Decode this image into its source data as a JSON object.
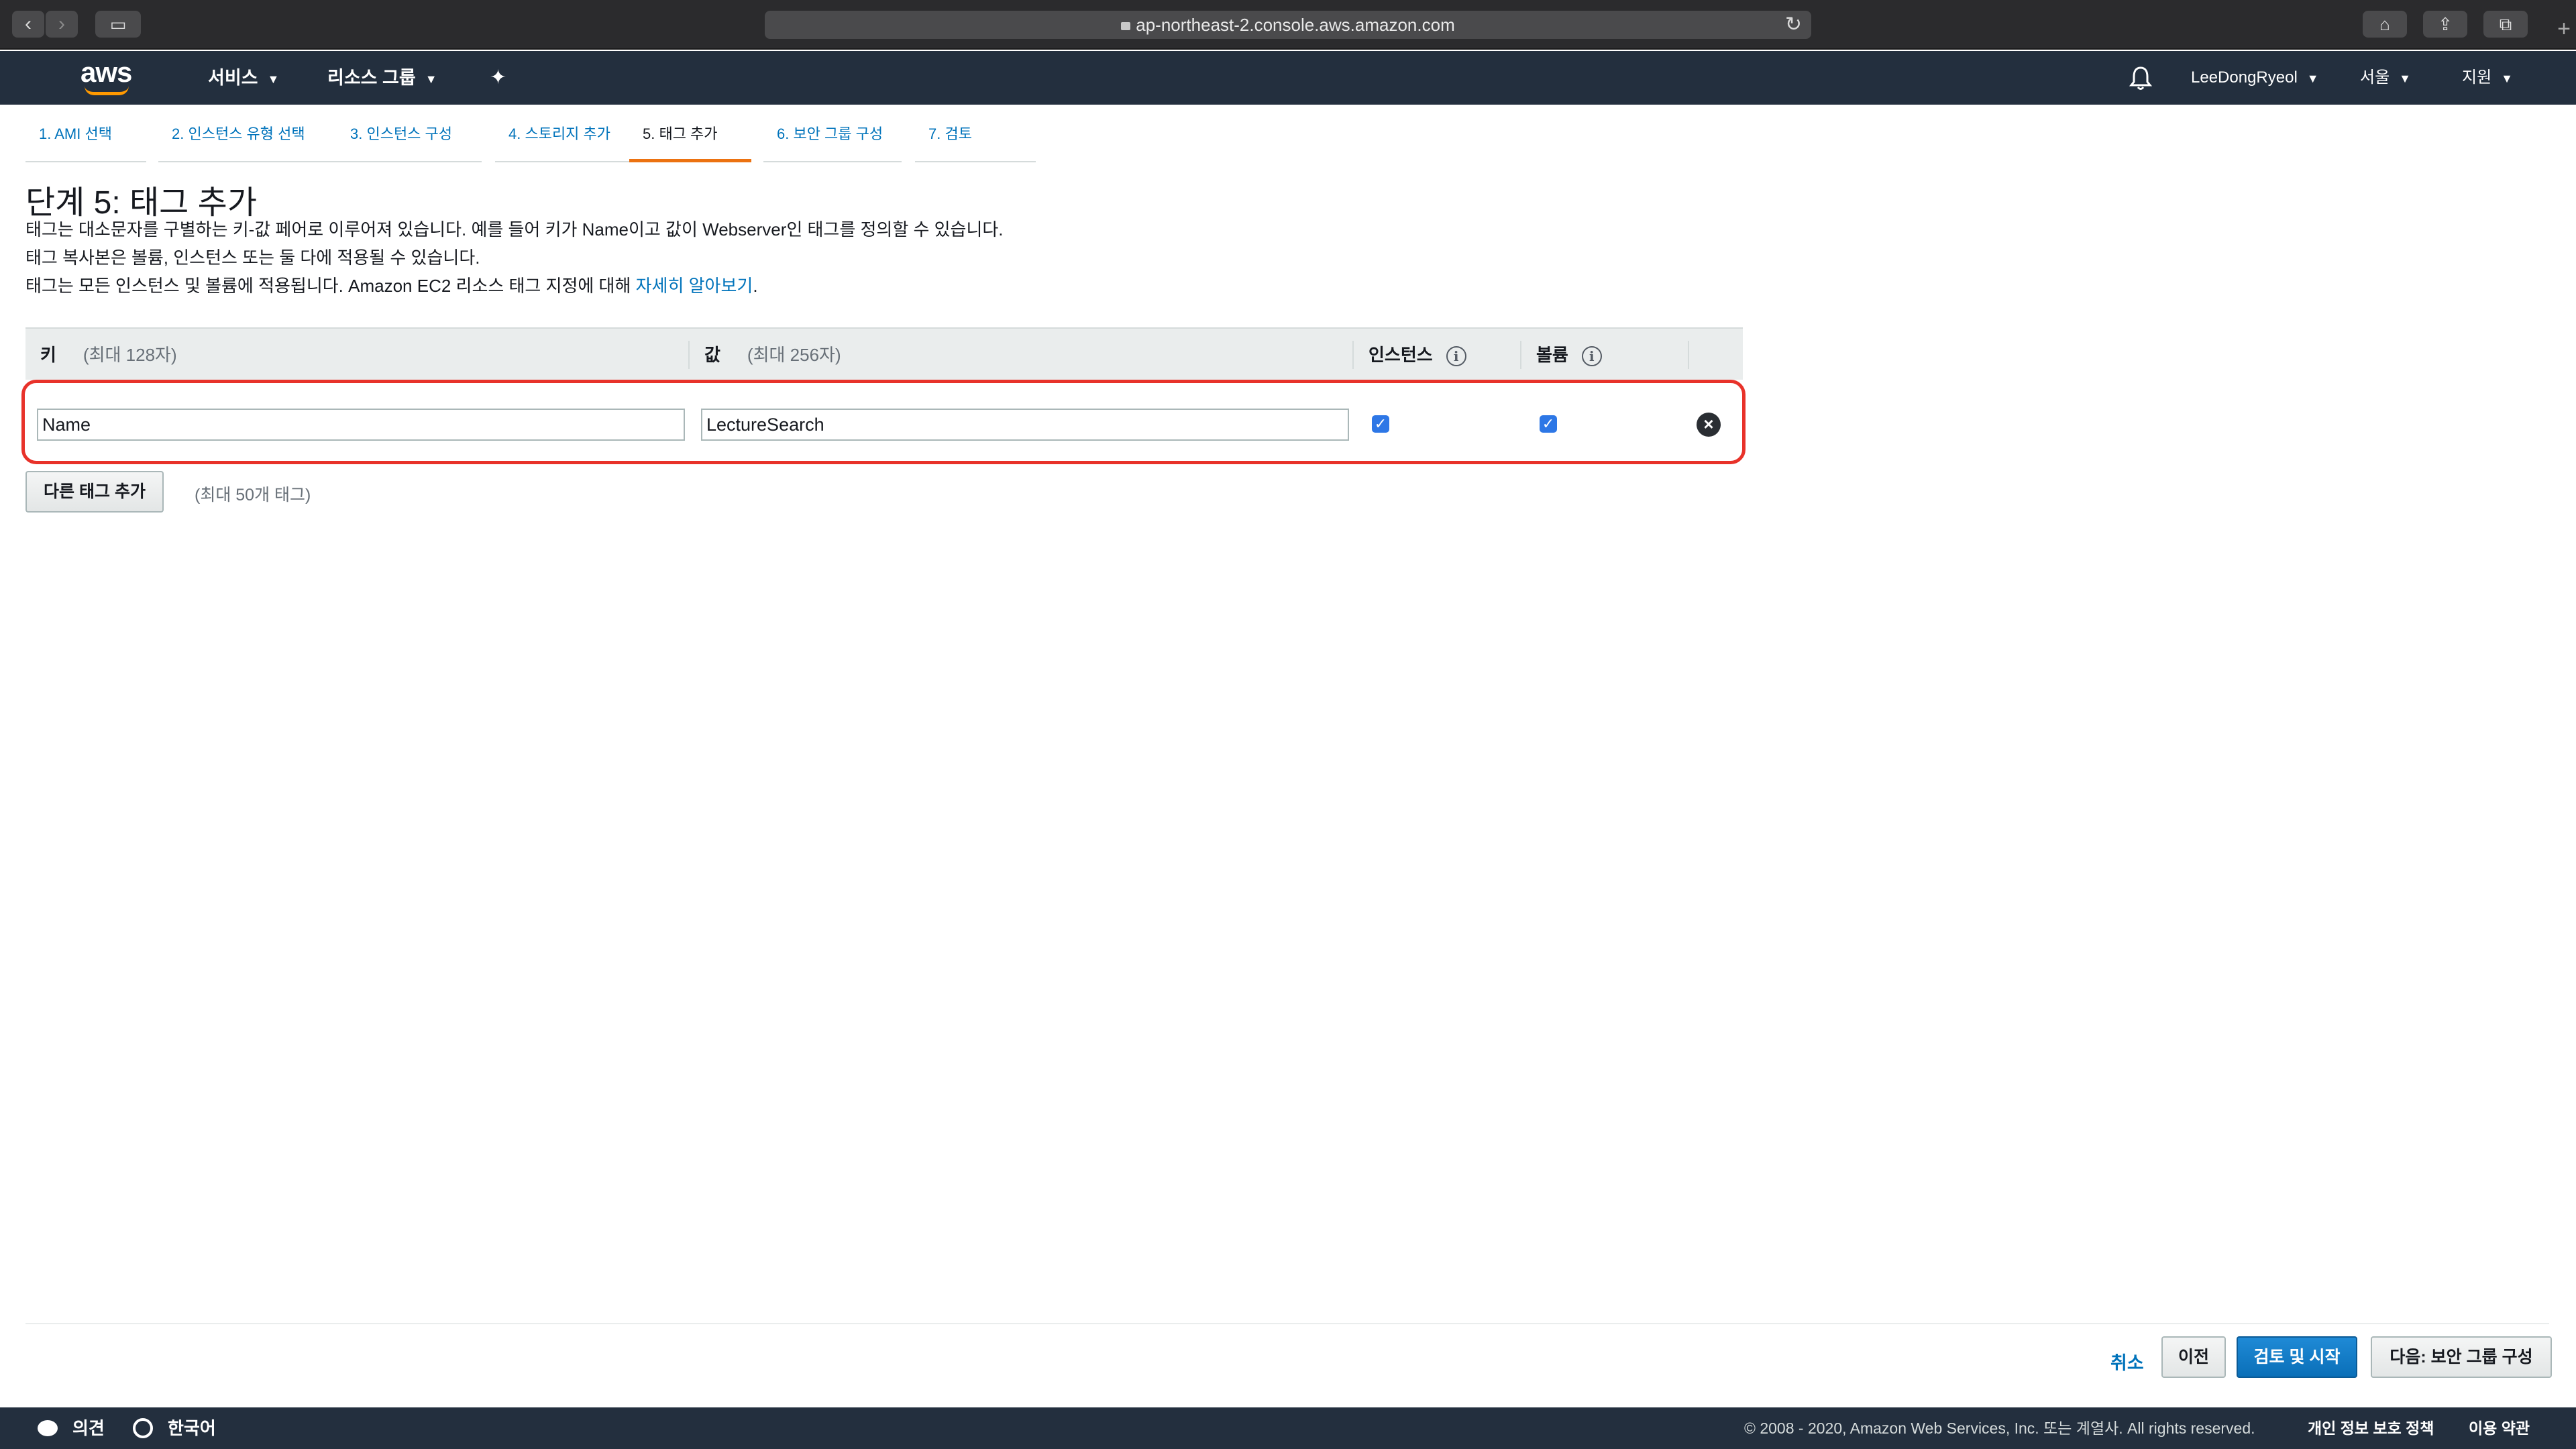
{
  "browser": {
    "url": "ap-northeast-2.console.aws.amazon.com",
    "back_icon": "‹",
    "forward_icon": "›",
    "sidebar_icon": "▭",
    "reload_icon": "↻",
    "home_icon": "⌂",
    "share_icon": "⇪",
    "tabs_icon": "⧉",
    "new_tab_icon": "+"
  },
  "header": {
    "logo": "aws",
    "services": "서비스",
    "resource_groups": "리소스 그룹",
    "pin_icon": "✦",
    "bell_icon": "🔔",
    "user": "LeeDongRyeol",
    "region": "서울",
    "support": "지원"
  },
  "steps": [
    {
      "label": "1. AMI 선택"
    },
    {
      "label": "2. 인스턴스 유형 선택"
    },
    {
      "label": "3. 인스턴스 구성"
    },
    {
      "label": "4. 스토리지 추가"
    },
    {
      "label": "5. 태그 추가"
    },
    {
      "label": "6. 보안 그룹 구성"
    },
    {
      "label": "7. 검토"
    }
  ],
  "page": {
    "title": "단계 5: 태그 추가",
    "desc1": "태그는 대소문자를 구별하는 키-값 페어로 이루어져 있습니다. 예를 들어 키가 Name이고 값이 Webserver인 태그를 정의할 수 있습니다.",
    "desc2": "태그 복사본은 볼륨, 인스턴스 또는 둘 다에 적용될 수 있습니다.",
    "desc3": "태그는 모든 인스턴스 및 볼륨에 적용됩니다. Amazon EC2 리소스 태그 지정에 대해",
    "learn_more": "자세히 알아보기",
    "desc3_end": "."
  },
  "table": {
    "col_key": "키",
    "col_key_hint": "(최대 128자)",
    "col_value": "값",
    "col_value_hint": "(최대 256자)",
    "col_instance": "인스턴스",
    "col_volume": "볼륨",
    "info_icon": "i",
    "rows": [
      {
        "key": "Name",
        "value": "LectureSearch",
        "instance": true,
        "volume": true
      }
    ],
    "check_icon": "✓",
    "delete_icon": "×"
  },
  "add_tag": {
    "button": "다른 태그 추가",
    "hint": "(최대 50개 태그)"
  },
  "actions": {
    "cancel": "취소",
    "previous": "이전",
    "review_launch": "검토 및 시작",
    "next": "다음: 보안 그룹 구성"
  },
  "footer": {
    "feedback": "의견",
    "language": "한국어",
    "copyright": "© 2008 - 2020, Amazon Web Services, Inc. 또는 계열사. All rights reserved.",
    "privacy": "개인 정보 보호 정책",
    "terms": "이용 약관"
  }
}
